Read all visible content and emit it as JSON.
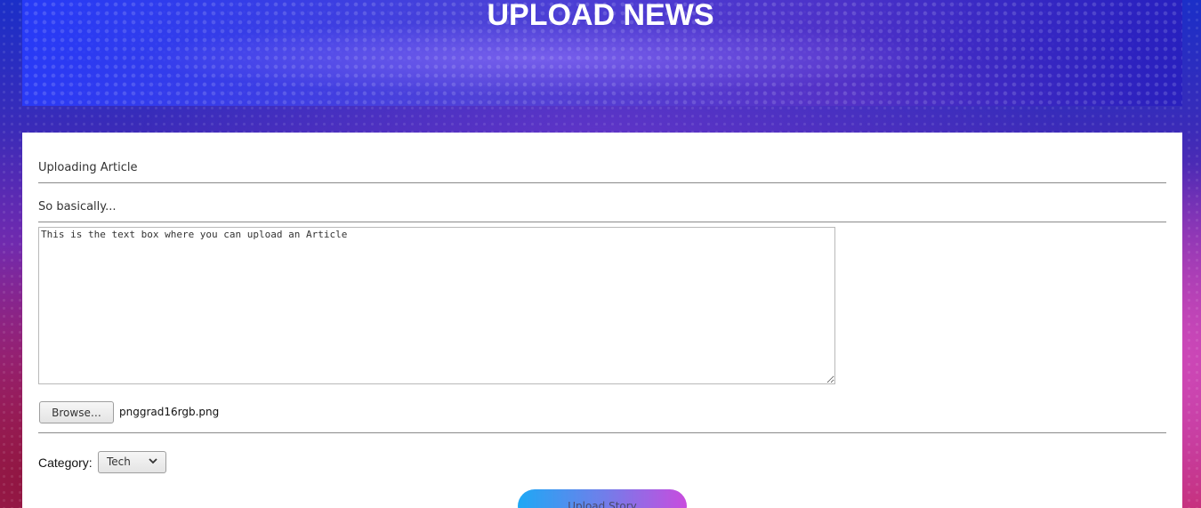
{
  "header": {
    "title": "UPLOAD NEWS"
  },
  "form": {
    "section_title": "Uploading Article",
    "subtitle": "So basically...",
    "article_text": "This is the text box where you can upload an Article",
    "file": {
      "browse_label": "Browse…",
      "selected_file": "pnggrad16rgb.png"
    },
    "category": {
      "label": "Category:",
      "selected": "Tech"
    },
    "submit_label": "Upload Story"
  },
  "colors": {
    "card_background": "#ffffff",
    "title_color": "#ffffff",
    "button_gradient_start": "#1ea8f5",
    "button_gradient_end": "#c84cde"
  },
  "icons": {
    "category_dropdown": "chevron-down-icon",
    "textarea_resize": "resize-handle-icon"
  }
}
